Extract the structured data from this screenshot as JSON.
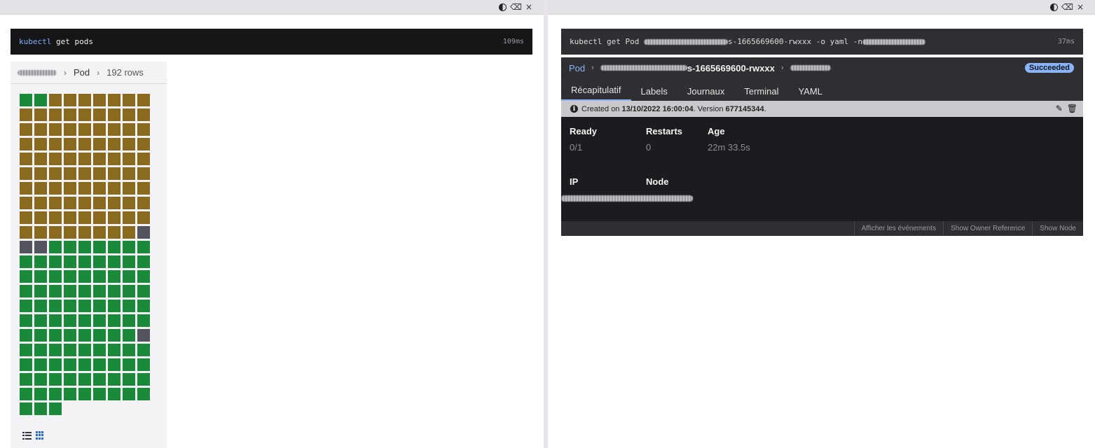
{
  "left": {
    "command": {
      "keyword": "kubectl",
      "rest": "get pods",
      "time": "109ms"
    },
    "breadcrumb": {
      "resource": "Pod",
      "rows": "192 rows"
    },
    "pods": {
      "statuses": [
        "g",
        "g",
        "b",
        "b",
        "b",
        "b",
        "b",
        "b",
        "b",
        "b",
        "b",
        "b",
        "b",
        "b",
        "b",
        "b",
        "b",
        "b",
        "b",
        "b",
        "b",
        "b",
        "b",
        "b",
        "b",
        "b",
        "b",
        "b",
        "b",
        "b",
        "b",
        "b",
        "b",
        "b",
        "b",
        "b",
        "b",
        "b",
        "b",
        "b",
        "b",
        "b",
        "b",
        "b",
        "b",
        "b",
        "b",
        "b",
        "b",
        "b",
        "b",
        "b",
        "b",
        "b",
        "b",
        "b",
        "b",
        "b",
        "b",
        "b",
        "b",
        "b",
        "b",
        "b",
        "b",
        "b",
        "b",
        "b",
        "b",
        "b",
        "b",
        "b",
        "b",
        "b",
        "b",
        "b",
        "b",
        "b",
        "b",
        "b",
        "b",
        "b",
        "b",
        "b",
        "b",
        "b",
        "b",
        "b",
        "b",
        "x",
        "x",
        "x",
        "g",
        "g",
        "g",
        "g",
        "g",
        "g",
        "g",
        "g",
        "g",
        "g",
        "g",
        "g",
        "g",
        "g",
        "g",
        "g",
        "g",
        "g",
        "g",
        "g",
        "g",
        "g",
        "g",
        "g",
        "g",
        "g",
        "g",
        "g",
        "g",
        "g",
        "g",
        "g",
        "g",
        "g",
        "g",
        "g",
        "g",
        "g",
        "g",
        "g",
        "g",
        "g",
        "g",
        "g",
        "g",
        "g",
        "g",
        "g",
        "g",
        "g",
        "g",
        "g",
        "g",
        "g",
        "g",
        "g",
        "g",
        "g",
        "g",
        "g",
        "x",
        "g",
        "g",
        "g",
        "g",
        "g",
        "g",
        "g",
        "g",
        "g",
        "g",
        "g",
        "g",
        "g",
        "g",
        "g",
        "g",
        "g",
        "g",
        "g",
        "g",
        "g",
        "g",
        "g",
        "g",
        "g",
        "g",
        "g",
        "g",
        "g",
        "g",
        "g",
        "g",
        "g",
        "g",
        "g",
        "g",
        "g",
        "g",
        "g"
      ],
      "colors": {
        "g": "#1a8a3a",
        "b": "#8a6a1e",
        "x": "#54545e"
      }
    }
  },
  "right": {
    "command": {
      "prefix": "kubectl get Pod",
      "pod_suffix": "s-1665669600-rwxxx",
      "flags": "-o yaml -n",
      "time": "37ms"
    },
    "header": {
      "resource": "Pod",
      "pod_suffix": "s-1665669600-rwxxx",
      "status": "Succeeded"
    },
    "tabs": [
      "Récapitulatif",
      "Labels",
      "Journaux",
      "Terminal",
      "YAML"
    ],
    "info": {
      "created_prefix": "Created on",
      "created_date": "13/10/2022 16:00:04",
      "version_prefix": ". Version",
      "version": "677145344",
      "suffix": "."
    },
    "fields": {
      "ready_label": "Ready",
      "ready_value": "0/1",
      "restarts_label": "Restarts",
      "restarts_value": "0",
      "age_label": "Age",
      "age_value": "22m 33.5s",
      "ip_label": "IP",
      "node_label": "Node"
    },
    "footer": [
      "Afficher les événements",
      "Show Owner Reference",
      "Show Node"
    ]
  }
}
